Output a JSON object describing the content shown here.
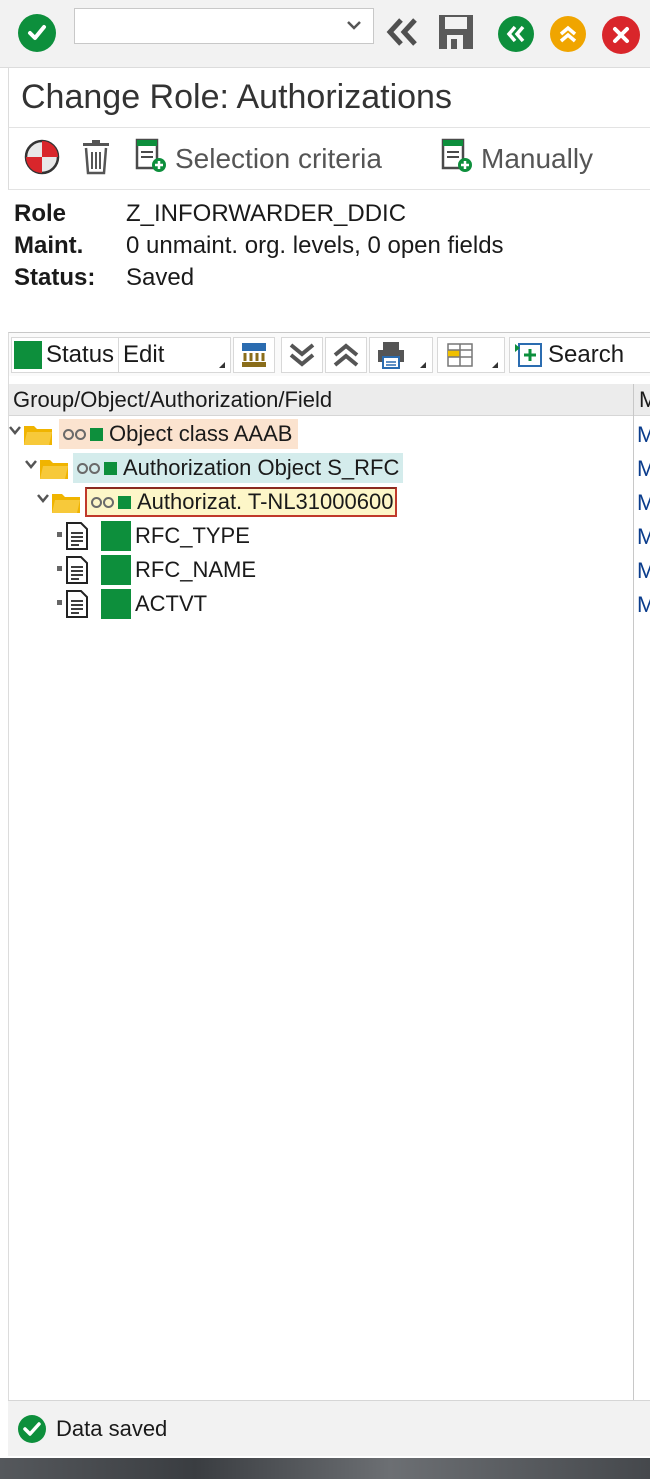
{
  "system_toolbar": {
    "command_field_value": "",
    "icons": [
      "check-circle-icon",
      "dropdown-chevron-icon",
      "back-double-chevron-icon",
      "save-disk-icon",
      "back-icon",
      "exit-icon",
      "cancel-icon"
    ],
    "colors": {
      "check": "#0d8f3c",
      "back": "#0d8f3c",
      "exit": "#f0a500",
      "cancel": "#d9262b"
    }
  },
  "title": "Change Role: Authorizations",
  "app_toolbar": {
    "selection_criteria_label": "Selection criteria",
    "manually_label": "Manually"
  },
  "header": {
    "role_label": "Role",
    "role_value": "Z_INFORWARDER_DDIC",
    "maint_label": "Maint.",
    "maint_value": "0 unmaint. org. levels, 0 open fields",
    "status_label": "Status:",
    "status_value": "Saved"
  },
  "tree_toolbar": {
    "status_label": "Status",
    "edit_label": "Edit",
    "search_label": "Search"
  },
  "tree": {
    "column_1": "Group/Object/Authorization/Field",
    "column_2": "M",
    "rows": [
      {
        "label": "Object class AAAB",
        "m": "M"
      },
      {
        "label": "Authorization Object S_RFC",
        "m": "M"
      },
      {
        "label": "Authorizat. T-NL31000600",
        "m": "M"
      },
      {
        "label": "RFC_TYPE",
        "m": "M"
      },
      {
        "label": "RFC_NAME",
        "m": "M"
      },
      {
        "label": "ACTVT",
        "m": "M"
      }
    ]
  },
  "status_bar": {
    "message": "Data saved"
  },
  "colors": {
    "row_object_class_bg": "#fbe3cf",
    "row_auth_object_bg": "#d4ecec",
    "row_authorization_bg": "#fdf6c8",
    "status_green": "#0d8f3c"
  }
}
